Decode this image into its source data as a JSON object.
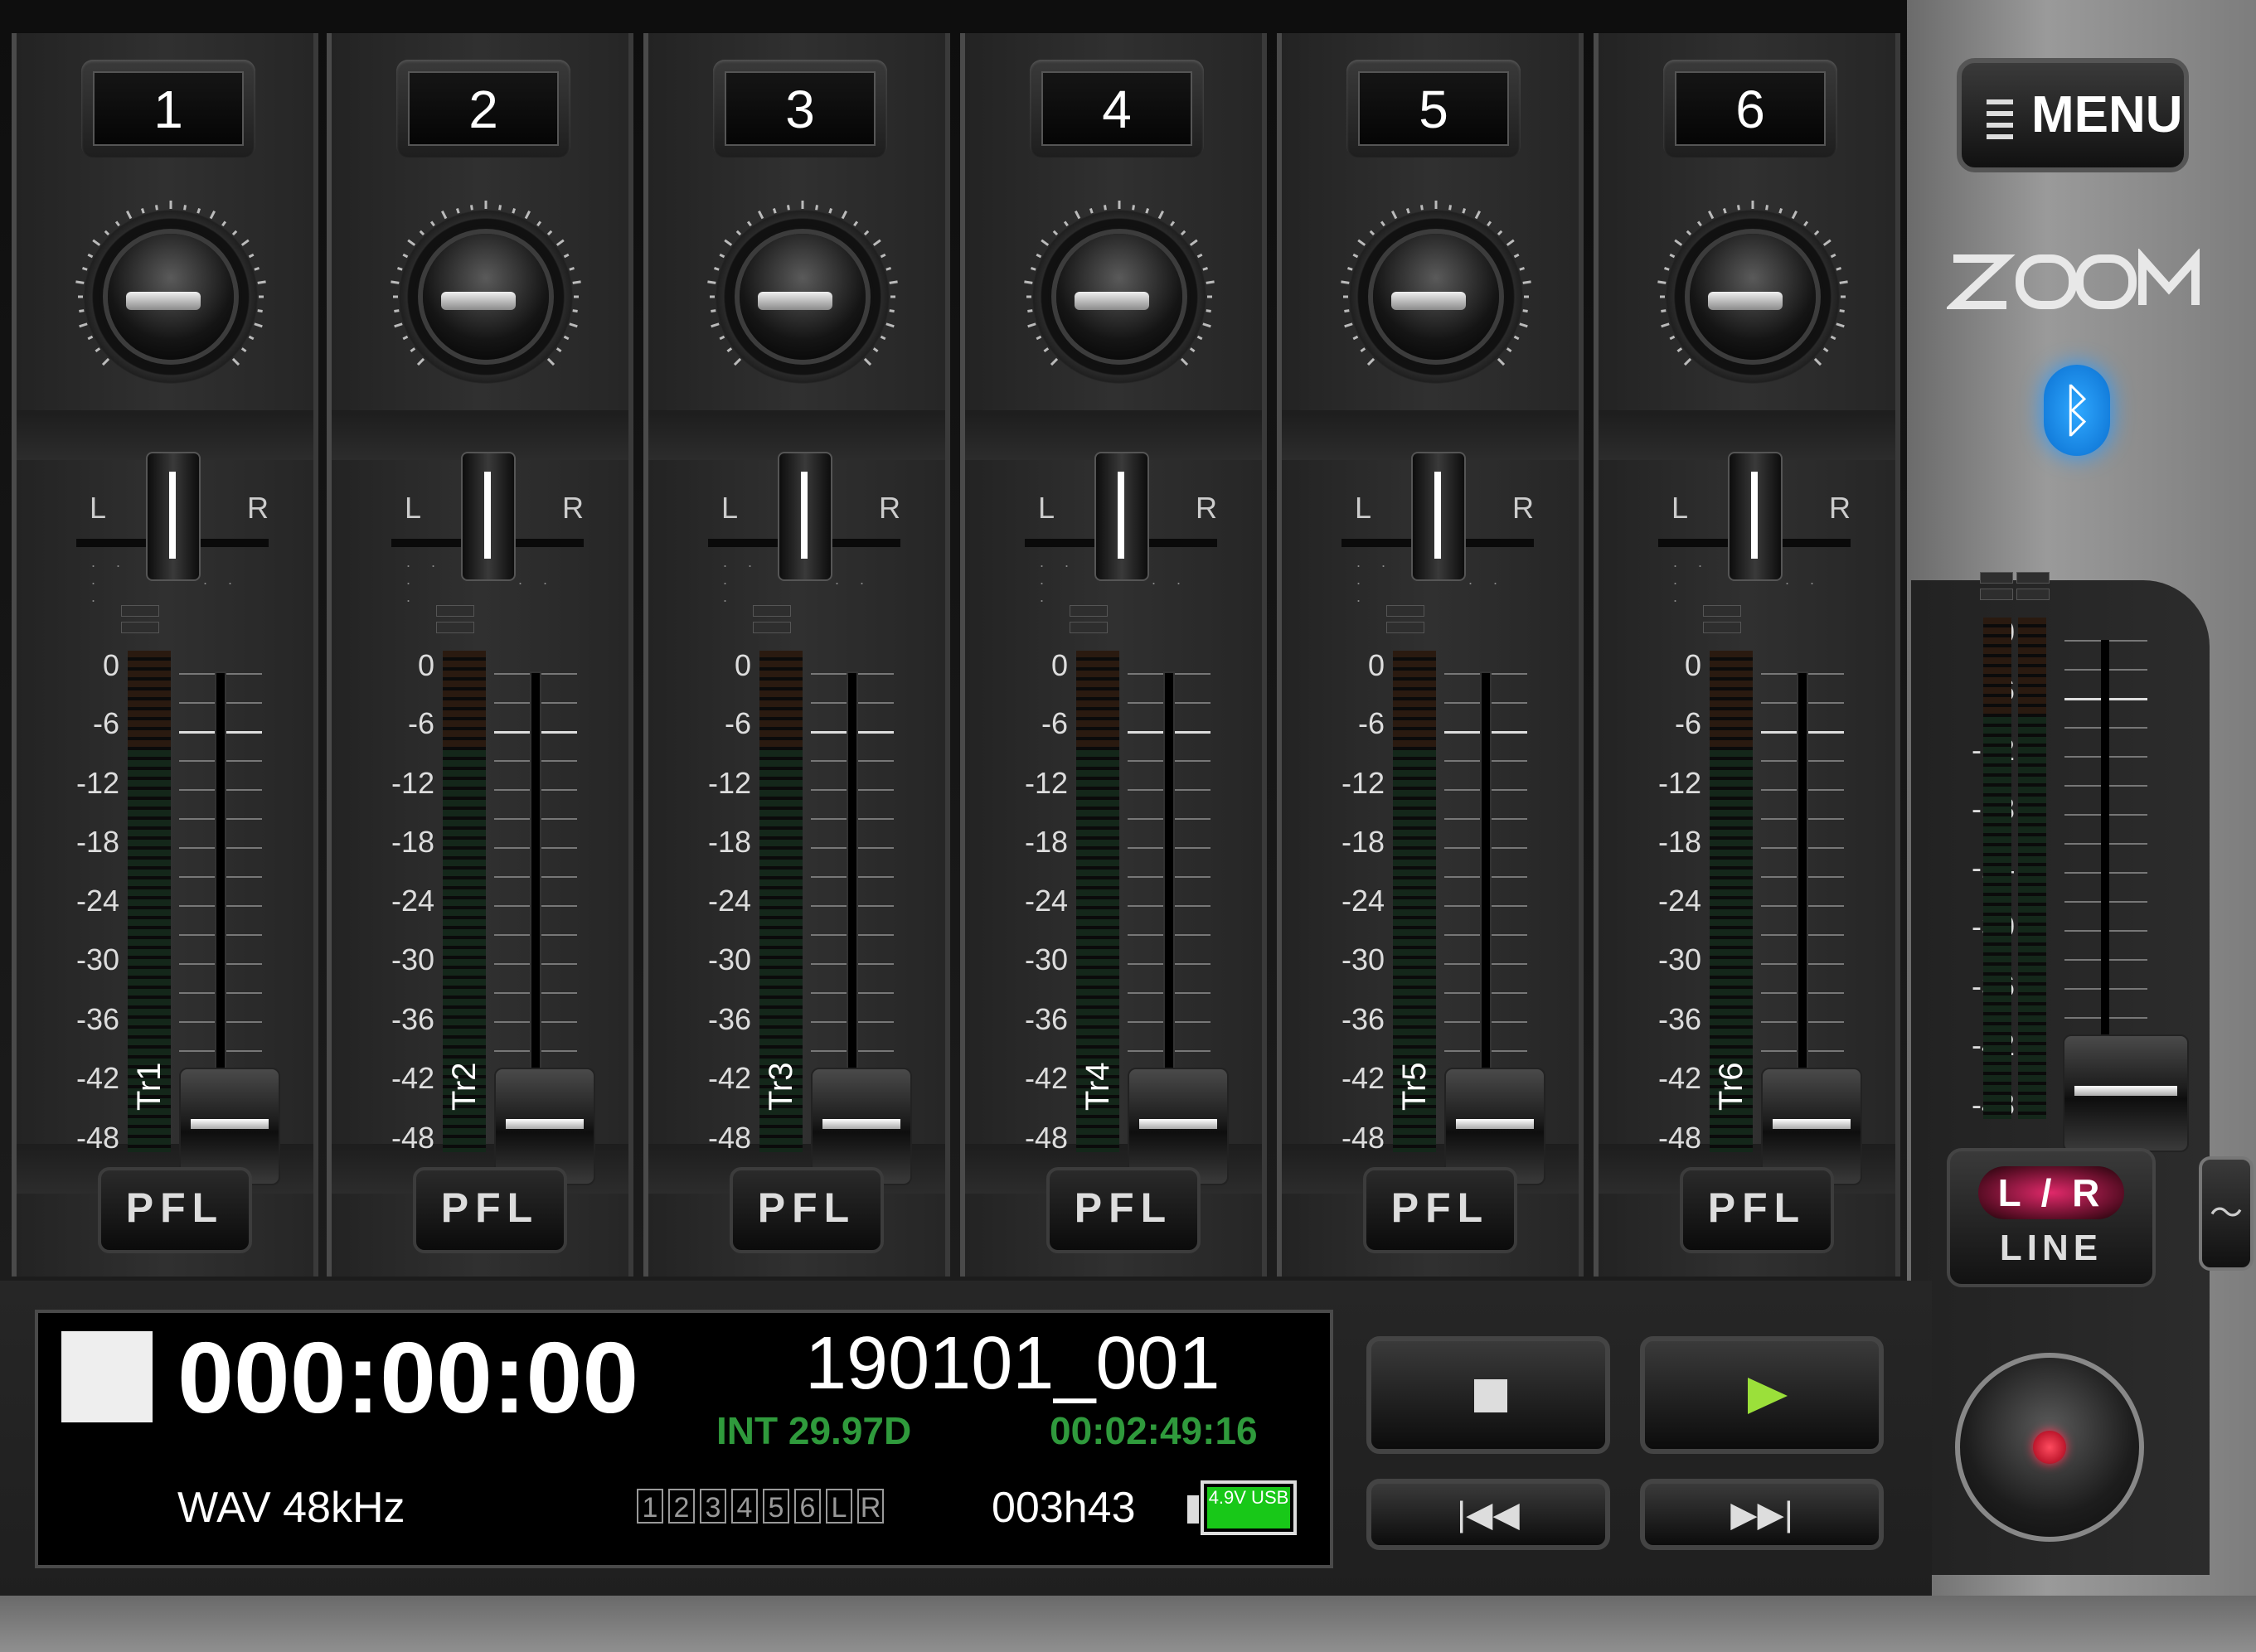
{
  "channels": [
    {
      "number": "1",
      "track": "Tr1"
    },
    {
      "number": "2",
      "track": "Tr2"
    },
    {
      "number": "3",
      "track": "Tr3"
    },
    {
      "number": "4",
      "track": "Tr4"
    },
    {
      "number": "5",
      "track": "Tr5"
    },
    {
      "number": "6",
      "track": "Tr6"
    }
  ],
  "pan": {
    "left_label": "L",
    "right_label": "R"
  },
  "meter_scale": [
    "0",
    "-6",
    "-12",
    "-18",
    "-24",
    "-30",
    "-36",
    "-42",
    "-48"
  ],
  "pfl_label": "PFL",
  "menu": {
    "label": "MENU",
    "icon": "hamburger-icon"
  },
  "brand": {
    "logo": "ZOOM",
    "bluetooth_icon": "bluetooth-icon",
    "bluetooth_color": "#2a9bff"
  },
  "master": {
    "top_label": "L / R",
    "bottom_label": "LINE"
  },
  "side_tab_icon": "wave-icon",
  "display": {
    "timecode": "000:00:00",
    "filename": "190101_001",
    "frame_rate": "INT 29.97D",
    "timecode_generator": "00:02:49:16",
    "format": "WAV 48kHz",
    "track_flags": [
      "1",
      "2",
      "3",
      "4",
      "5",
      "6",
      "L",
      "R"
    ],
    "remaining": "003h43",
    "battery": "4.9V USB",
    "accent_green": "#2f9a3c"
  },
  "transport": {
    "stop_icon": "stop-icon",
    "play_icon": "play-icon",
    "rewind_label": "|◀◀",
    "fastforward_label": "▶▶|",
    "record_icon": "record-icon"
  }
}
